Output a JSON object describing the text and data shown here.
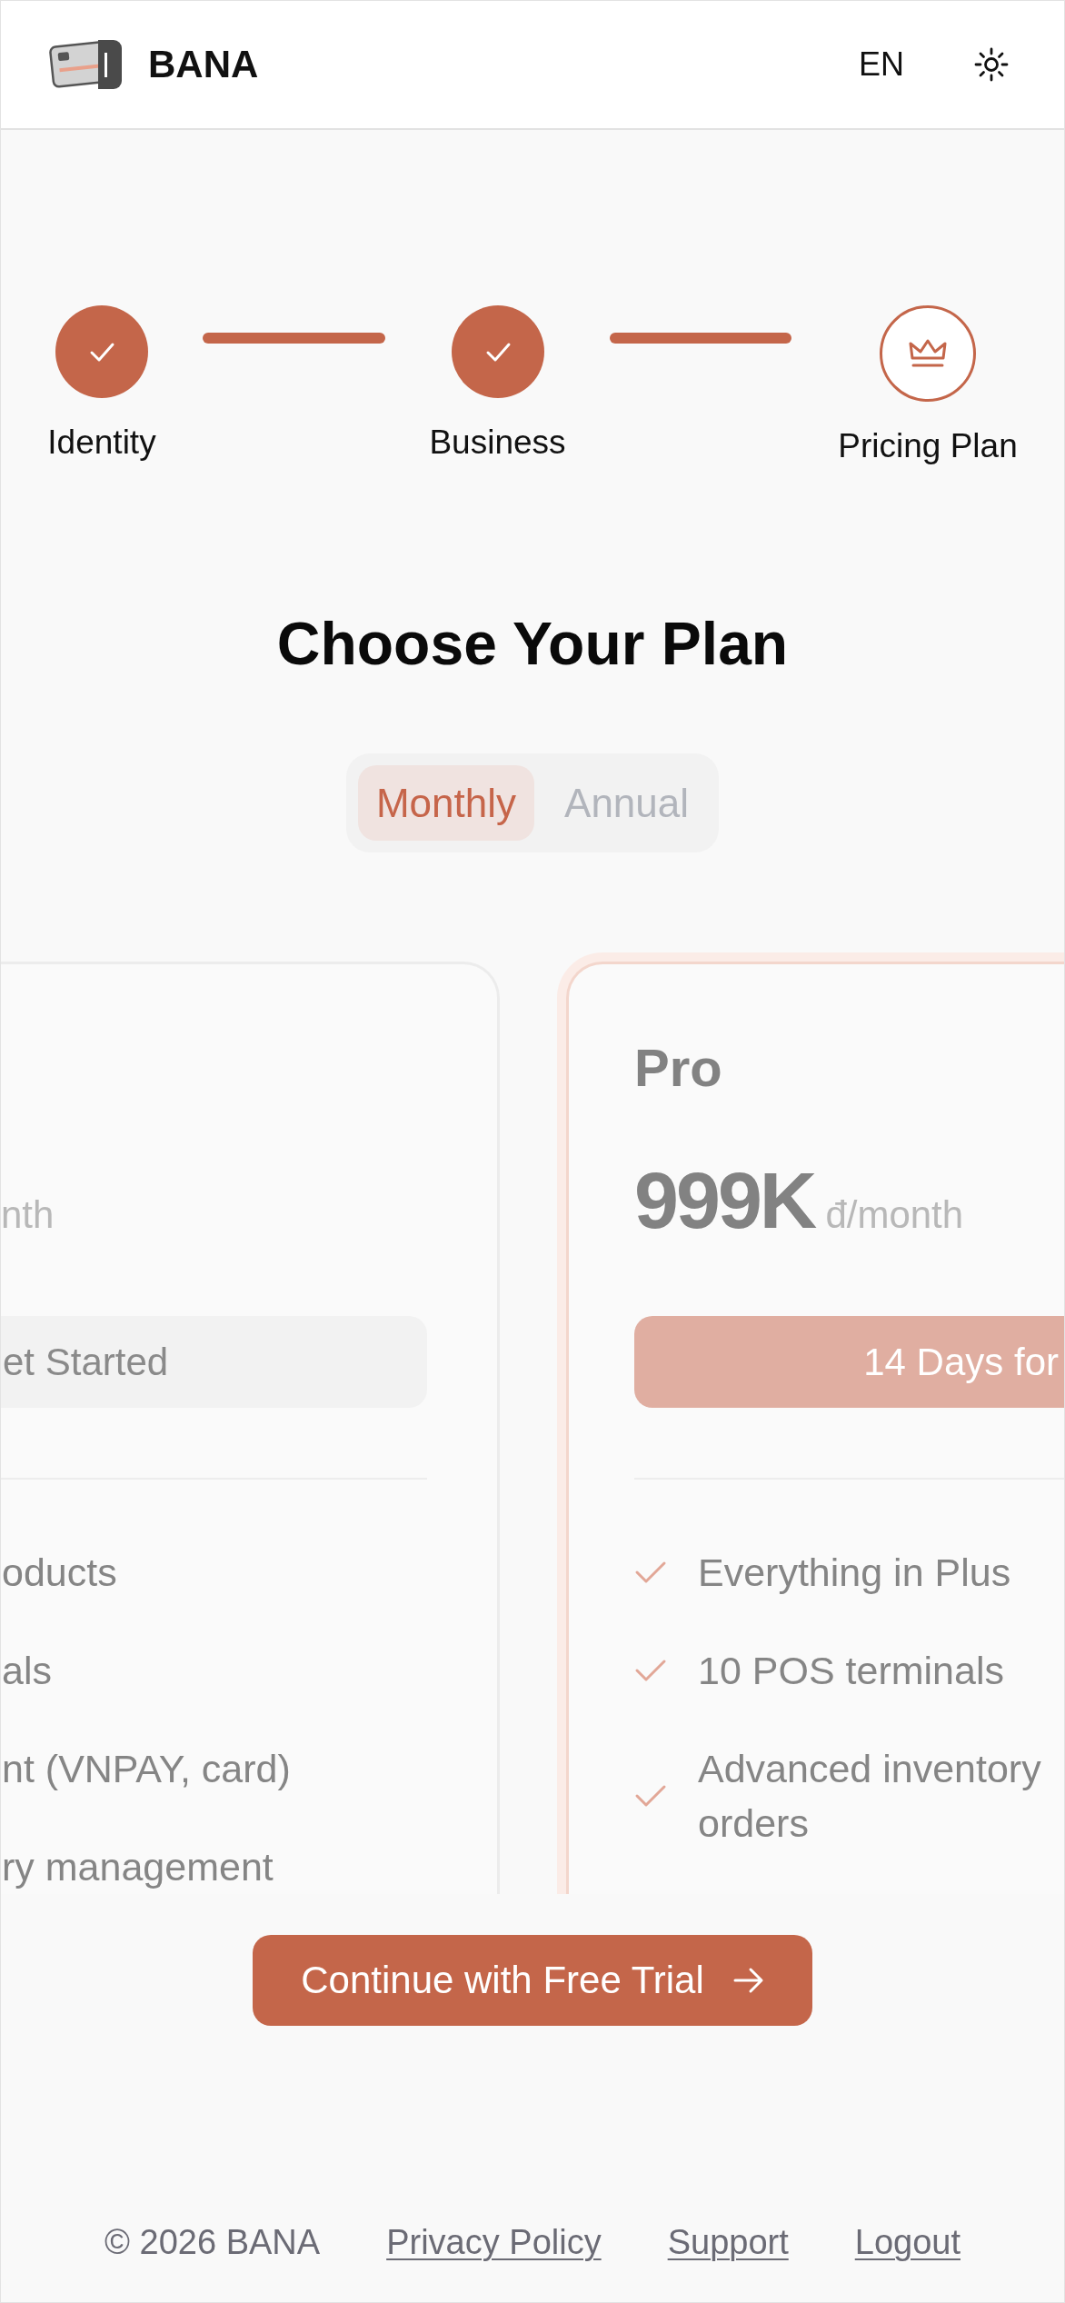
{
  "header": {
    "brand": "BANA",
    "language": "EN"
  },
  "steps": [
    {
      "label": "Identity",
      "completed": true
    },
    {
      "label": "Business",
      "completed": true
    },
    {
      "label": "Pricing Plan",
      "completed": false
    }
  ],
  "title": "Choose Your Plan",
  "billing": [
    {
      "label": "Monthly",
      "selected": true
    },
    {
      "label": "Annual",
      "selected": false
    }
  ],
  "plans": [
    {
      "kind": "clipped",
      "highlighted": false,
      "period": "nth",
      "cta": {
        "label": "et Started",
        "primary": false
      },
      "features": [
        "oducts",
        "als",
        "nt (VNPAY, card)",
        "ry management"
      ]
    },
    {
      "kind": "full",
      "highlighted": true,
      "name": "Pro",
      "price": "999K",
      "period": "đ/month",
      "cta": {
        "label": "14 Days for",
        "primary": true
      },
      "features": [
        "Everything in Plus",
        "10 POS terminals",
        "Advanced inventory orders"
      ]
    }
  ],
  "continue_button": {
    "label": "Continue with Free Trial"
  },
  "footer": {
    "copyright": "© 2026 BANA",
    "links": [
      "Privacy Policy",
      "Support",
      "Logout"
    ]
  }
}
